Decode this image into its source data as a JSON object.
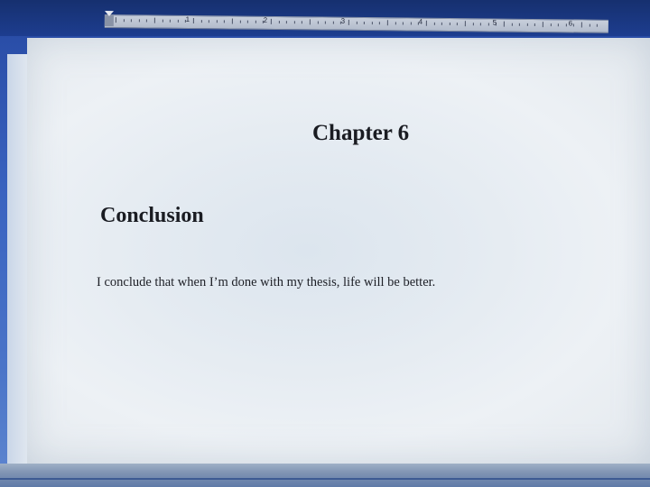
{
  "ruler": {
    "numbers": [
      "1",
      "2",
      "3",
      "4",
      "5",
      "6"
    ]
  },
  "document": {
    "chapter_title": "Chapter 6",
    "section_heading": "Conclusion",
    "body_text": "I conclude that when I’m done with my thesis, life will be better."
  }
}
